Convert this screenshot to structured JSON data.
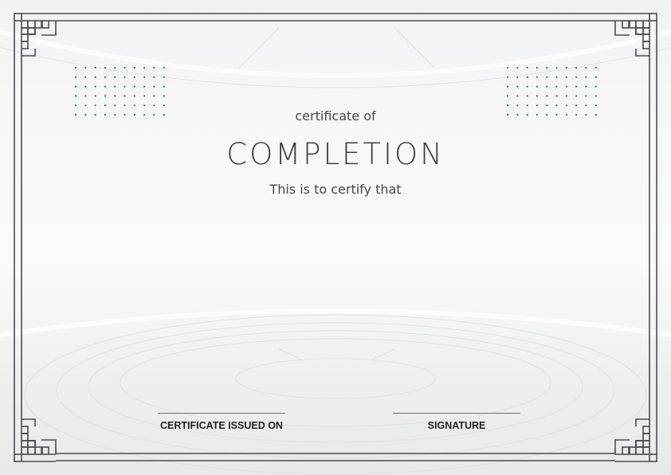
{
  "certificate": {
    "pretitle": "certificate of",
    "title": "COMPLETION",
    "subtitle": "This is to certify that",
    "issued_label": "CERTIFICATE ISSUED ON",
    "signature_label": "SIGNATURE"
  },
  "colors": {
    "border": "#4a4d52",
    "dots": "#2a7d5f",
    "text": "#3e4043"
  }
}
